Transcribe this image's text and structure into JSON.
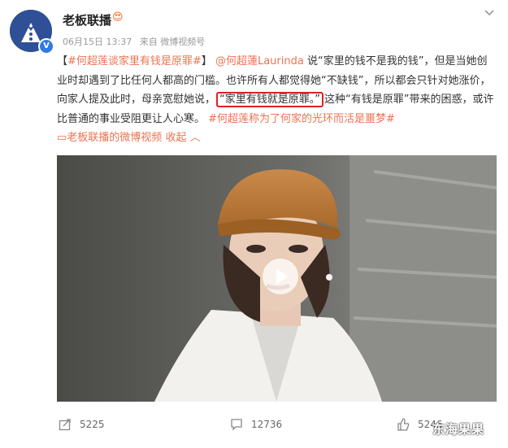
{
  "post": {
    "author": "老板联播",
    "date": "06月15日 13:37",
    "source": "来自 微博视频号",
    "text": {
      "bracket_open": "【",
      "topic1": "#何超莲谈家里有钱是原罪#",
      "bracket_close": "】",
      "mention": "@何超蓮Laurinda",
      "part1": " 说“家里的钱不是我的钱”，但是当她创业时却遇到了比任何人都高的门槛。也许所有人都觉得她“不缺钱”，所以都会只针对她涨价，向家人提及此时，母亲宽慰她说，",
      "highlight": "“家里有钱就是原罪。”",
      "part2": "这种“有钱是原罪”带来的困惑，或许比普通的事业受阻更让人心寒。",
      "topic2": "#何超莲称为了何家的光环而活是噩梦#",
      "video_link": "老板联播的微博视频",
      "collapse": "收起"
    },
    "stats": {
      "reposts": "5225",
      "comments": "12736",
      "likes": "5246"
    },
    "watermark": "东海果果"
  },
  "icons": [
    "avatar-logo",
    "verified-icon",
    "fire-emoji-icon",
    "chevron-down-icon",
    "video-link-icon",
    "collapse-arrow-icon",
    "play-icon",
    "repost-icon",
    "comment-icon",
    "like-icon"
  ]
}
